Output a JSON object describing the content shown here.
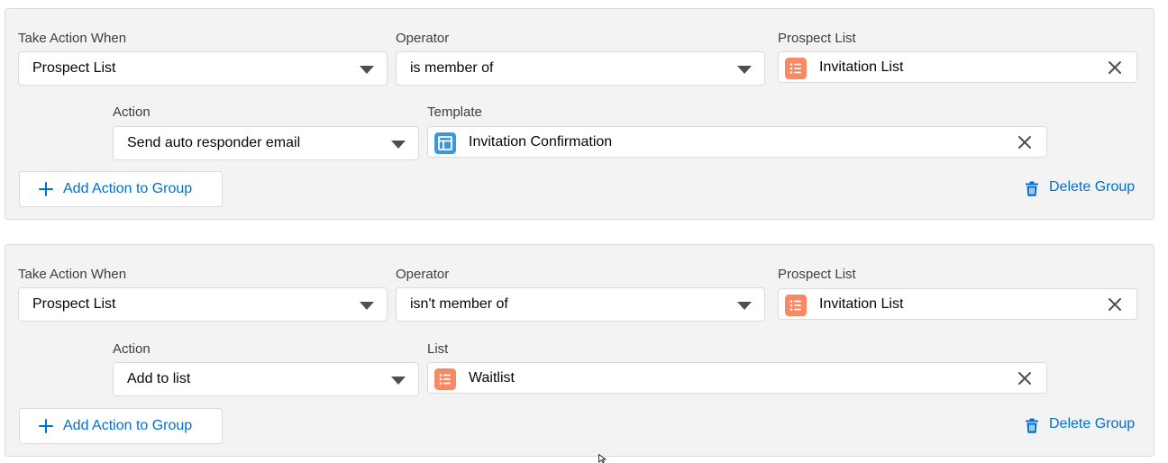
{
  "colors": {
    "list_icon": "#f88962",
    "template_icon": "#3c97dd",
    "link": "#0070d2"
  },
  "groups": [
    {
      "take_action_when": {
        "label": "Take Action When",
        "value": "Prospect List"
      },
      "operator": {
        "label": "Operator",
        "value": "is member of"
      },
      "prospect_list": {
        "label": "Prospect List",
        "value": "Invitation List",
        "icon": "list-icon"
      },
      "action": {
        "label": "Action",
        "value": "Send auto responder email"
      },
      "target": {
        "label": "Template",
        "value": "Invitation Confirmation",
        "icon": "template-icon"
      },
      "add_action_label": "Add Action to Group",
      "delete_group_label": "Delete Group"
    },
    {
      "take_action_when": {
        "label": "Take Action When",
        "value": "Prospect List"
      },
      "operator": {
        "label": "Operator",
        "value": "isn't member of"
      },
      "prospect_list": {
        "label": "Prospect List",
        "value": "Invitation List",
        "icon": "list-icon"
      },
      "action": {
        "label": "Action",
        "value": "Add to list"
      },
      "target": {
        "label": "List",
        "value": "Waitlist",
        "icon": "list-icon"
      },
      "add_action_label": "Add Action to Group",
      "delete_group_label": "Delete Group"
    }
  ]
}
